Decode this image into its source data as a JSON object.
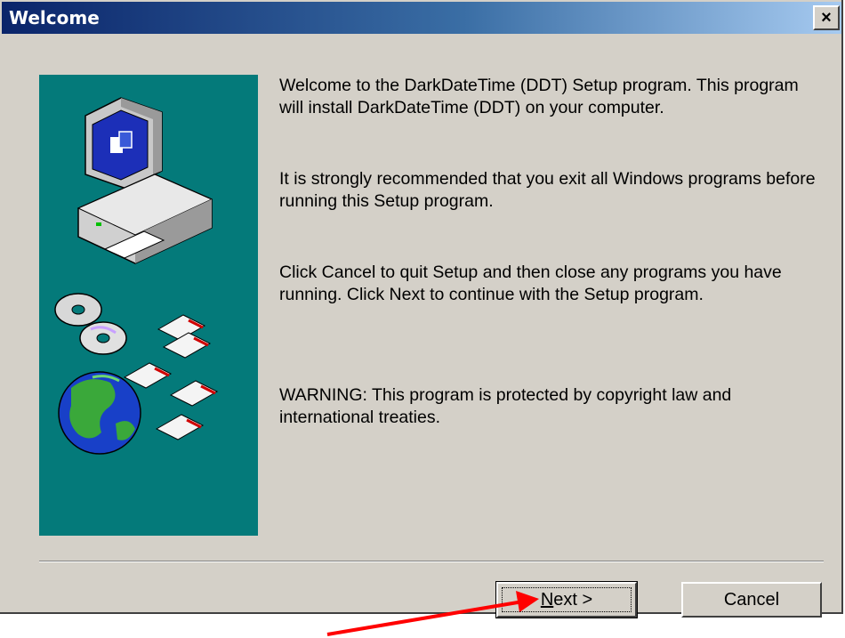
{
  "window": {
    "title": "Welcome",
    "close_glyph": "×"
  },
  "side_panel": {
    "icons": [
      "computer-icon",
      "cd-icon",
      "floppy-disk-icon",
      "globe-icon"
    ]
  },
  "messages": {
    "intro": "Welcome to the DarkDateTime (DDT) Setup program.  This program will install DarkDateTime (DDT) on your computer.",
    "recommend": "It is strongly recommended that you exit all Windows programs before running this Setup program.",
    "instructions": "Click Cancel to quit Setup and then close any programs you have running.  Click Next to continue with the Setup program.",
    "warning": "WARNING: This program is protected by copyright law and international treaties."
  },
  "buttons": {
    "next_prefix": "",
    "next_mnemonic": "N",
    "next_rest": "ext >",
    "cancel": "Cancel"
  },
  "colors": {
    "panel": "#047a7a",
    "dialog": "#d4d0c8",
    "annotation_arrow": "#ff0000"
  }
}
